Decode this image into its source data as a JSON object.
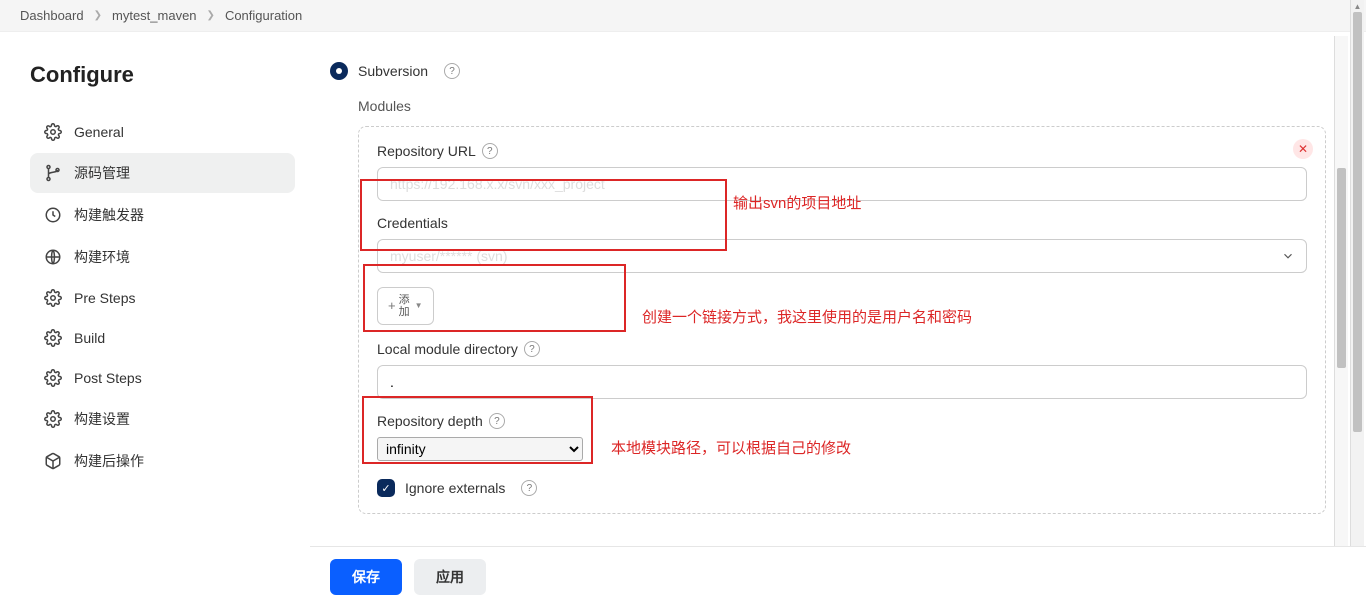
{
  "breadcrumb": [
    "Dashboard",
    "mytest_maven",
    "Configuration"
  ],
  "page_title": "Configure",
  "sidebar": {
    "items": [
      {
        "label": "General",
        "icon": "gear"
      },
      {
        "label": "源码管理",
        "icon": "branch",
        "active": true
      },
      {
        "label": "构建触发器",
        "icon": "clock"
      },
      {
        "label": "构建环境",
        "icon": "globe"
      },
      {
        "label": "Pre Steps",
        "icon": "gear"
      },
      {
        "label": "Build",
        "icon": "gear"
      },
      {
        "label": "Post Steps",
        "icon": "gear"
      },
      {
        "label": "构建设置",
        "icon": "gear"
      },
      {
        "label": "构建后操作",
        "icon": "box"
      }
    ]
  },
  "scm": {
    "type_label": "Subversion",
    "modules_label": "Modules",
    "repo_url_label": "Repository URL",
    "repo_url_value": "https://192.168.x.x/svn/xxx_project",
    "credentials_label": "Credentials",
    "credentials_value": "myuser/****** (svn)",
    "add_label": "添\n加",
    "local_dir_label": "Local module directory",
    "local_dir_value": ".",
    "depth_label": "Repository depth",
    "depth_value": "infinity",
    "ignore_ext_label": "Ignore externals"
  },
  "annotations": {
    "a1": "输出svn的项目地址",
    "a2": "创建一个链接方式，我这里使用的是用户名和密码",
    "a3": "本地模块路径，可以根据自己的修改"
  },
  "footer": {
    "save": "保存",
    "apply": "应用"
  }
}
